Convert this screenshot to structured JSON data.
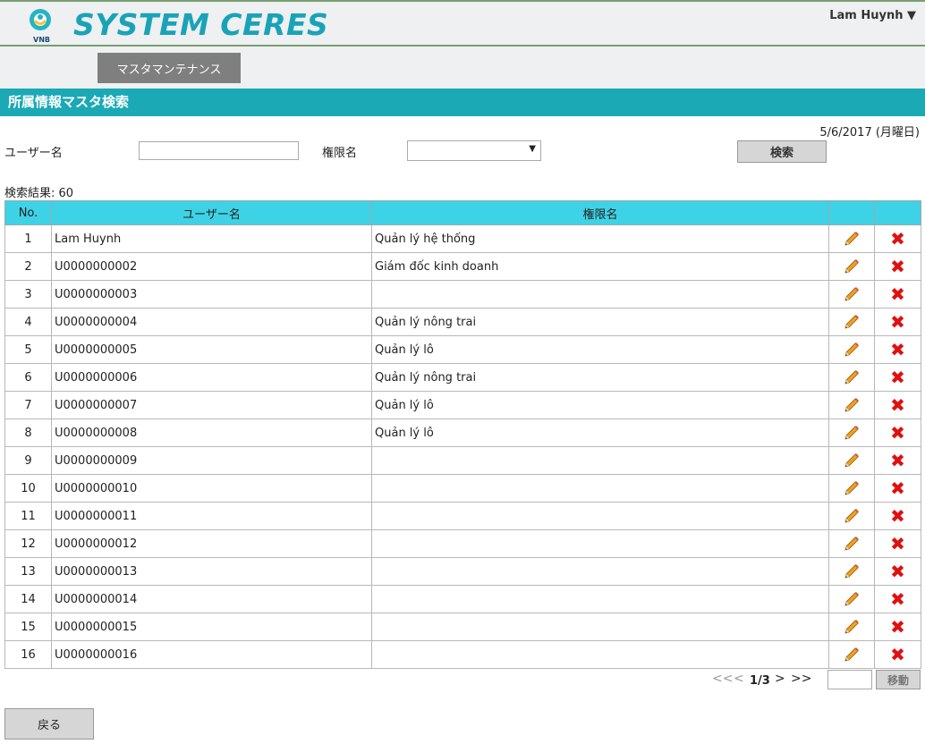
{
  "header": {
    "logo_text": "VNB",
    "app_title": "SYSTEM CERES",
    "user_menu": "Lam Huynh ▼"
  },
  "nav": {
    "maintenance_button": "マスタマンテナンス"
  },
  "page_title": "所属情報マスタ検索",
  "date": "5/6/2017 (月曜日)",
  "search": {
    "username_label": "ユーザー名",
    "username_value": "",
    "role_label": "権限名",
    "role_selected": "",
    "search_button": "検索"
  },
  "results": {
    "count_text": "検索結果: 60",
    "columns": [
      "No.",
      "ユーザー名",
      "権限名",
      "",
      ""
    ],
    "rows": [
      {
        "no": "1",
        "user": "Lam Huynh",
        "role": "Quản lý hệ thống"
      },
      {
        "no": "2",
        "user": "U0000000002",
        "role": "Giám đốc kinh doanh"
      },
      {
        "no": "3",
        "user": "U0000000003",
        "role": ""
      },
      {
        "no": "4",
        "user": "U0000000004",
        "role": "Quản lý nông trai"
      },
      {
        "no": "5",
        "user": "U0000000005",
        "role": "Quản lý lô"
      },
      {
        "no": "6",
        "user": "U0000000006",
        "role": "Quản lý nông trai"
      },
      {
        "no": "7",
        "user": "U0000000007",
        "role": "Quản lý lô"
      },
      {
        "no": "8",
        "user": "U0000000008",
        "role": "Quản lý lô"
      },
      {
        "no": "9",
        "user": "U0000000009",
        "role": ""
      },
      {
        "no": "10",
        "user": "U0000000010",
        "role": ""
      },
      {
        "no": "11",
        "user": "U0000000011",
        "role": ""
      },
      {
        "no": "12",
        "user": "U0000000012",
        "role": ""
      },
      {
        "no": "13",
        "user": "U0000000013",
        "role": ""
      },
      {
        "no": "14",
        "user": "U0000000014",
        "role": ""
      },
      {
        "no": "15",
        "user": "U0000000015",
        "role": ""
      },
      {
        "no": "16",
        "user": "U0000000016",
        "role": ""
      }
    ]
  },
  "pagination": {
    "first": "<<",
    "prev": "<",
    "page_indicator": "1/3",
    "next": ">",
    "last": ">>",
    "page_input_value": "",
    "go_button": "移動"
  },
  "back_button": "戻る",
  "colors": {
    "accent": "#1ba9b6",
    "table_header": "#3ed2e6",
    "nav_button": "#7f7f7f",
    "delete": "#e01010",
    "edit": "#f0a020"
  },
  "icons": {
    "edit": "pencil-icon",
    "delete": "delete-x-icon"
  }
}
